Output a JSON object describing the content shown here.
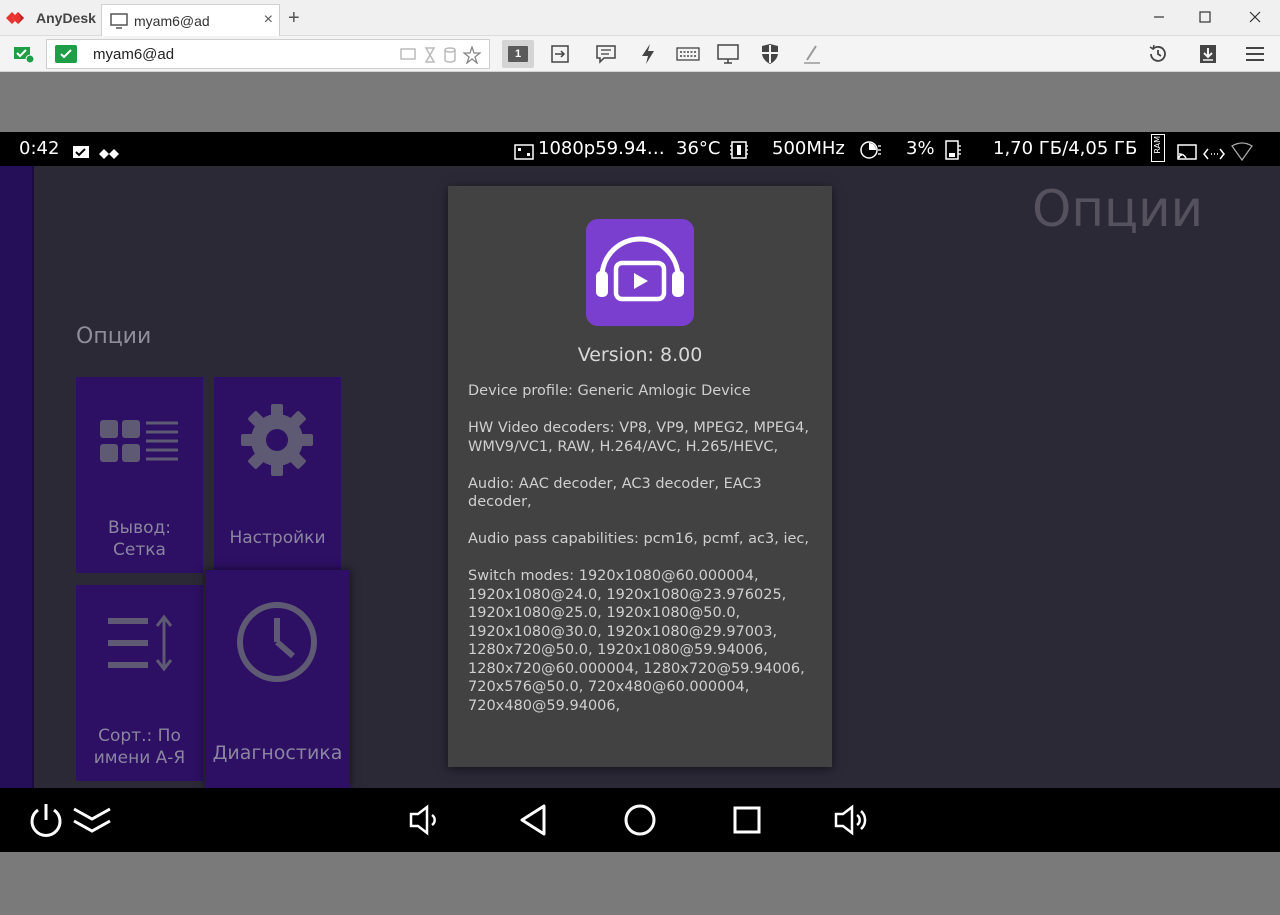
{
  "app": {
    "name": "AnyDesk",
    "tab_label": "myam6@ad",
    "tab_close": "×",
    "new_tab": "+"
  },
  "toolbar": {
    "address_value": "myam6@ad",
    "display_number": "1"
  },
  "colors": {
    "anydesk_red": "#e8332f",
    "connected_green": "#1e9e46",
    "tile_purple": "#2d0f63",
    "app_icon_purple": "#7b3fd0",
    "dialog_bg": "#424242",
    "remote_bg": "#2b2936"
  },
  "remote": {
    "status_bar": {
      "time": "0:42",
      "resolution": "1080p59.94…",
      "temperature": "36°C",
      "cpu_freq": "500MHz",
      "cpu_load": "3%",
      "memory": "1,70 ГБ/4,05 ГБ",
      "ram_label": "RAM"
    },
    "page_title": "Опции",
    "section_label": "Опции",
    "tiles": {
      "output": "Вывод: Сетка",
      "settings": "Настройки",
      "sort": "Сорт.: По имени А-Я",
      "diagnostics": "Диагностика"
    },
    "dialog": {
      "version": "Version: 8.00",
      "device_profile": "Device profile: Generic Amlogic Device",
      "hw_decoders": "HW Video decoders: VP8, VP9, MPEG2, MPEG4, WMV9/VC1, RAW, H.264/AVC, H.265/HEVC,",
      "audio": "Audio: AAC decoder, AC3 decoder, EAC3 decoder,",
      "audio_pass": "Audio pass capabilities: pcm16, pcmf, ac3, iec,",
      "switch_modes": "Switch modes: 1920x1080@60.000004,\n1920x1080@24.0, 1920x1080@23.976025,\n1920x1080@25.0, 1920x1080@50.0,\n1920x1080@30.0, 1920x1080@29.97003,\n1280x720@50.0, 1920x1080@59.94006,\n1280x720@60.000004, 1280x720@59.94006,\n720x576@50.0, 720x480@60.000004,\n720x480@59.94006,"
    }
  },
  "icons": {
    "brand": "anydesk-logo-icon",
    "tab": "monitor-icon",
    "window": [
      "minimize-icon",
      "maximize-icon",
      "close-icon"
    ],
    "toolbar_left": [
      "connection-status-icon"
    ],
    "toolbar_actions": [
      "display-select-icon",
      "transfer-icon",
      "chat-icon",
      "actions-lightning-icon",
      "keyboard-icon",
      "view-monitor-icon",
      "permissions-shield-icon",
      "whiteboard-pen-icon"
    ],
    "toolbar_right": [
      "history-icon",
      "install-icon",
      "menu-icon"
    ],
    "navbar": [
      "power-icon",
      "collapse-chevrons-icon",
      "volume-down-icon",
      "back-icon",
      "home-icon",
      "recents-icon",
      "volume-up-icon"
    ]
  }
}
